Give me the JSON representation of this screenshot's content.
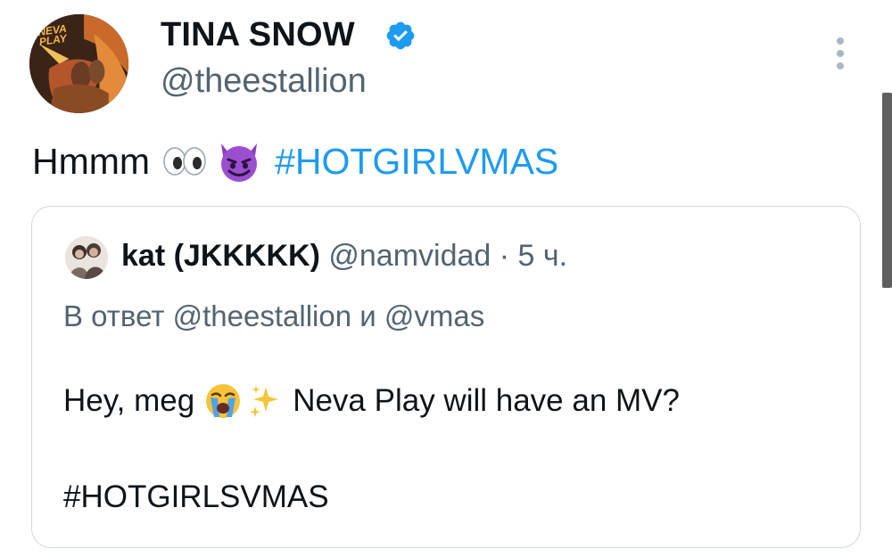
{
  "author": {
    "display_name": "TINA SNOW",
    "handle": "@theestallion",
    "avatar_text": "NEVA PLAY",
    "verified_icon": "verified-badge-icon",
    "verified_color": "#1d9bf0"
  },
  "menu_icon": "more-vertical-icon",
  "tweet": {
    "text": "Hmmm",
    "emojis": [
      "eyes-emoji",
      "smiling-imp-emoji"
    ],
    "hashtag": "#HOTGIRLVMAS"
  },
  "quote": {
    "display_name": "kat (JKKKKK)",
    "handle": "@namvidad",
    "separator": "·",
    "time": "5 ч.",
    "reply_prefix": "В ответ",
    "reply_to_1": "@theestallion",
    "reply_conj": "и",
    "reply_to_2": "@vmas",
    "text_before": "Hey, meg",
    "emojis": [
      "loudly-crying-face-emoji",
      "sparkles-emoji"
    ],
    "text_after": "Neva Play will have an MV?",
    "hashtag": "#HOTGIRLSVMAS"
  },
  "colors": {
    "link": "#1d9bf0",
    "secondary_text": "#536471",
    "border": "#cfd9de"
  }
}
